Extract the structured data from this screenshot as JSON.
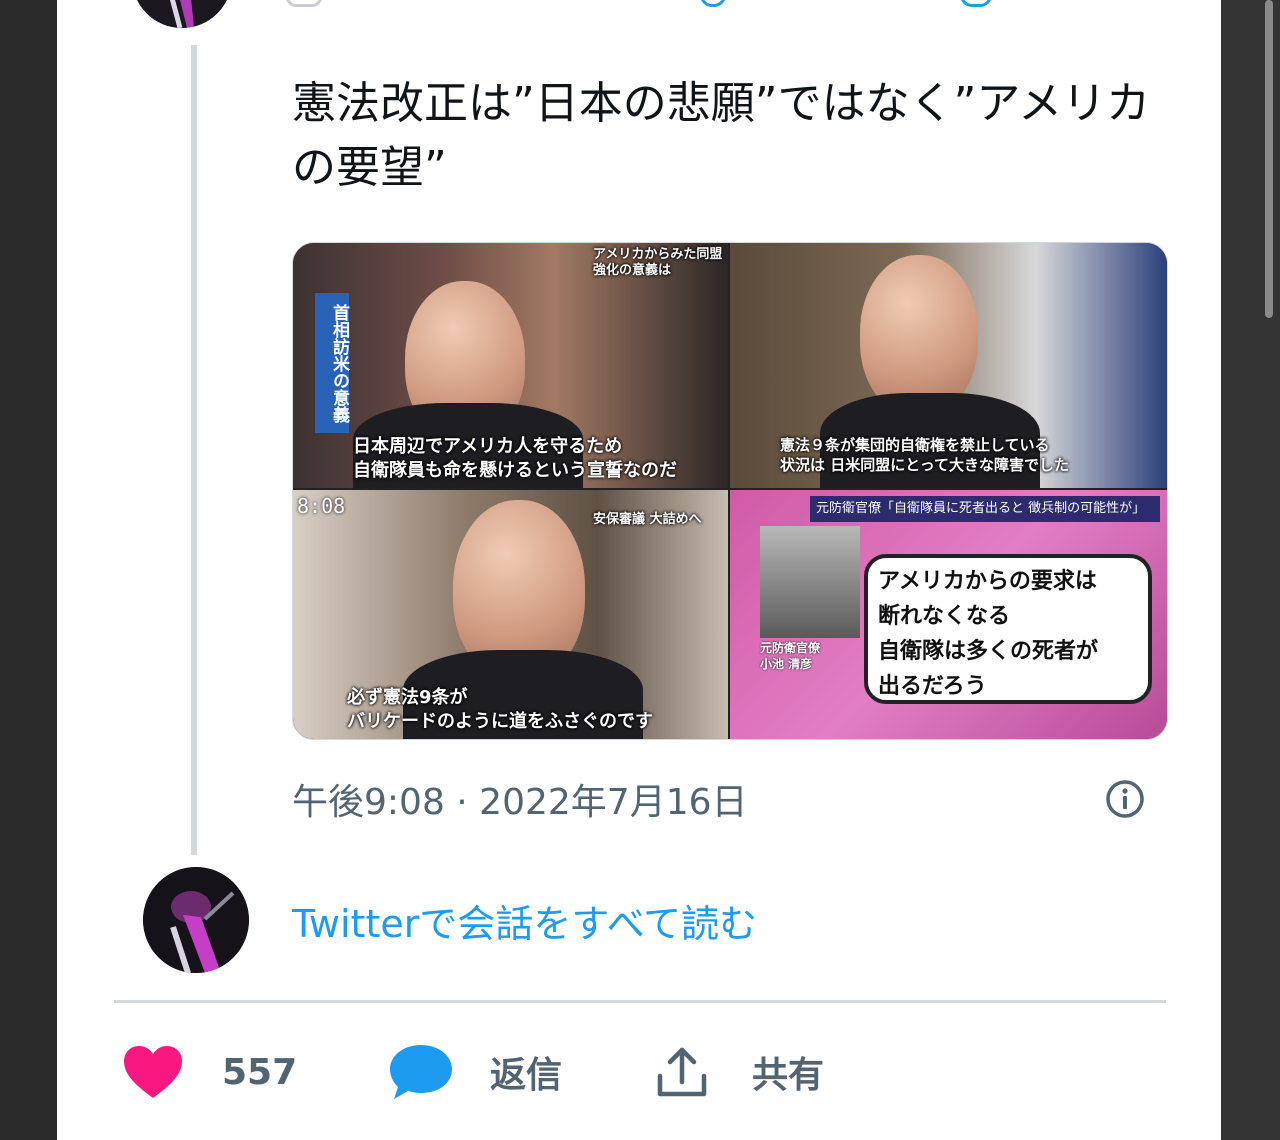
{
  "tweet": {
    "text": "憲法改正は”日本の悲願”ではなく”アメリカの要望”",
    "timestamp": "午後9:08 · 2022年7月16日",
    "media": {
      "panel1": {
        "side_label": "首相訪米の意義",
        "top_label": "アメリカからみた同盟強化の意義は",
        "caption_line1": "日本周辺でアメリカ人を守るため",
        "caption_line2": "自衛隊員も命を懸けるという宣誓なのだ"
      },
      "panel2": {
        "caption_line1": "憲法９条が集団的自衛権を禁止している",
        "caption_line2": "状況は 日米同盟にとって大きな障害でした"
      },
      "panel3": {
        "time": "8:08",
        "top_label": "安保審議 大詰めへ",
        "caption_line1": "必ず憲法9条が",
        "caption_line2": "バリケードのように道をふさぐのです"
      },
      "panel4": {
        "banner": "元防衛官僚「自衛隊員に死者出ると 徴兵制の可能性が」",
        "person_title": "元防衛官僚",
        "person_name": "小池 清彦",
        "bubble_line1": "アメリカからの要求は",
        "bubble_line2": "断れなくなる",
        "bubble_line3": "自衛隊は多くの死者が",
        "bubble_line4": "出るだろう"
      }
    }
  },
  "read_conversation": "Twitterで会話をすべて読む",
  "actions": {
    "like_count": "557",
    "reply_label": "返信",
    "share_label": "共有"
  },
  "colors": {
    "like": "#f91880",
    "reply": "#1d9bf0",
    "link": "#1d9bf0",
    "muted": "#536471"
  },
  "icons": [
    "info-icon",
    "heart-icon",
    "reply-bubble-icon",
    "share-icon"
  ]
}
